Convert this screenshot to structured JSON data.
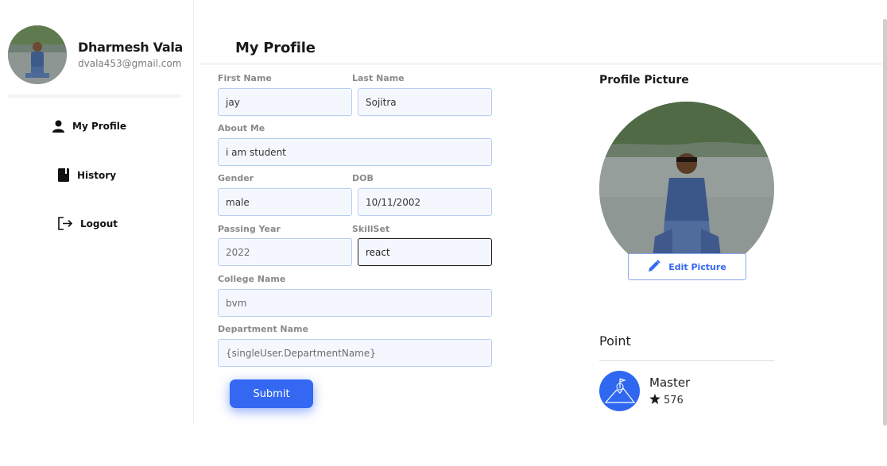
{
  "user": {
    "name": "Dharmesh Vala",
    "email": "dvala453@gmail.com"
  },
  "nav": [
    {
      "label": "My Profile",
      "icon": "user-icon"
    },
    {
      "label": "History",
      "icon": "book-icon"
    },
    {
      "label": "Logout",
      "icon": "logout-icon"
    }
  ],
  "page": {
    "title": "My Profile"
  },
  "form": {
    "first_name": {
      "label": "First Name",
      "value": "jay"
    },
    "last_name": {
      "label": "Last Name",
      "value": "Sojitra"
    },
    "about": {
      "label": "About Me",
      "value": "i am student"
    },
    "gender": {
      "label": "Gender",
      "value": "male"
    },
    "dob": {
      "label": "DOB",
      "value": "10/11/2002"
    },
    "passing_year": {
      "label": "Passing Year",
      "value": "2022"
    },
    "skillset": {
      "label": "SkillSet",
      "value": "react"
    },
    "college": {
      "label": "College Name",
      "value": "bvm"
    },
    "department": {
      "label": "Department Name",
      "value": "{singleUser.DepartmentName}"
    },
    "submit_label": "Submit"
  },
  "profile_picture": {
    "title": "Profile Picture",
    "edit_label": "Edit Picture"
  },
  "points": {
    "title": "Point",
    "rank": "Master",
    "score": "576"
  },
  "colors": {
    "accent": "#3468f2",
    "field_border": "#b9cdf0",
    "field_bg": "#f4f8fe"
  }
}
